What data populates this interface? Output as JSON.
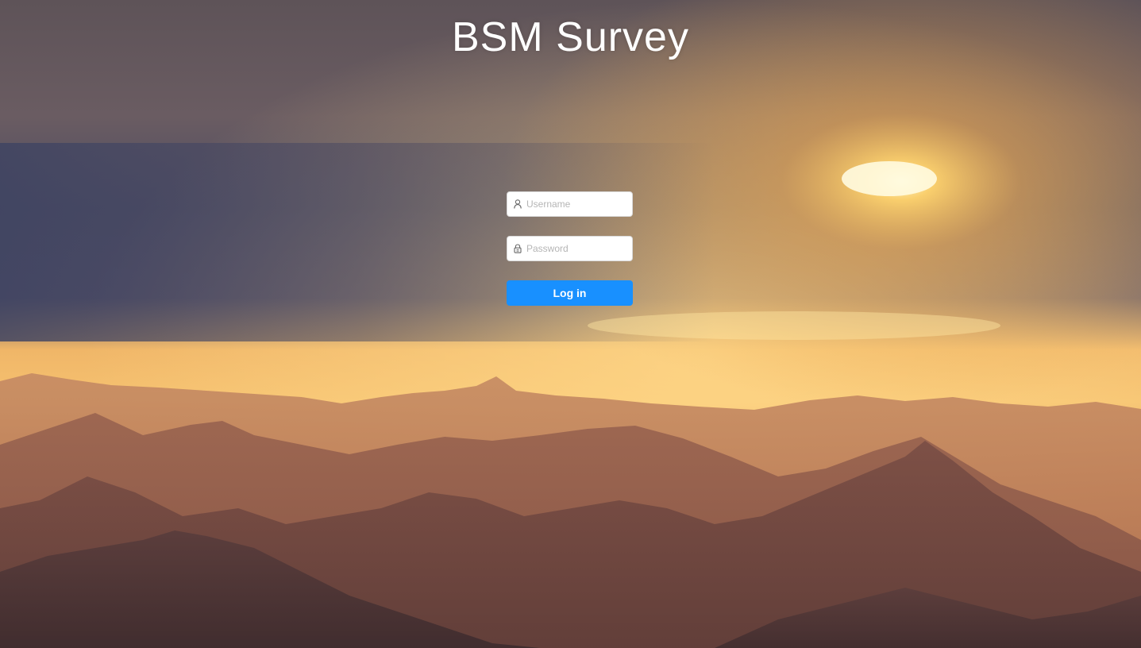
{
  "app": {
    "title": "BSM Survey"
  },
  "login_form": {
    "username": {
      "placeholder": "Username",
      "value": "",
      "icon": "user-icon"
    },
    "password": {
      "placeholder": "Password",
      "value": "",
      "icon": "lock-icon"
    },
    "submit_label": "Log in"
  },
  "colors": {
    "accent": "#1890ff",
    "title_text": "#ffffff",
    "input_background": "#ffffff"
  }
}
